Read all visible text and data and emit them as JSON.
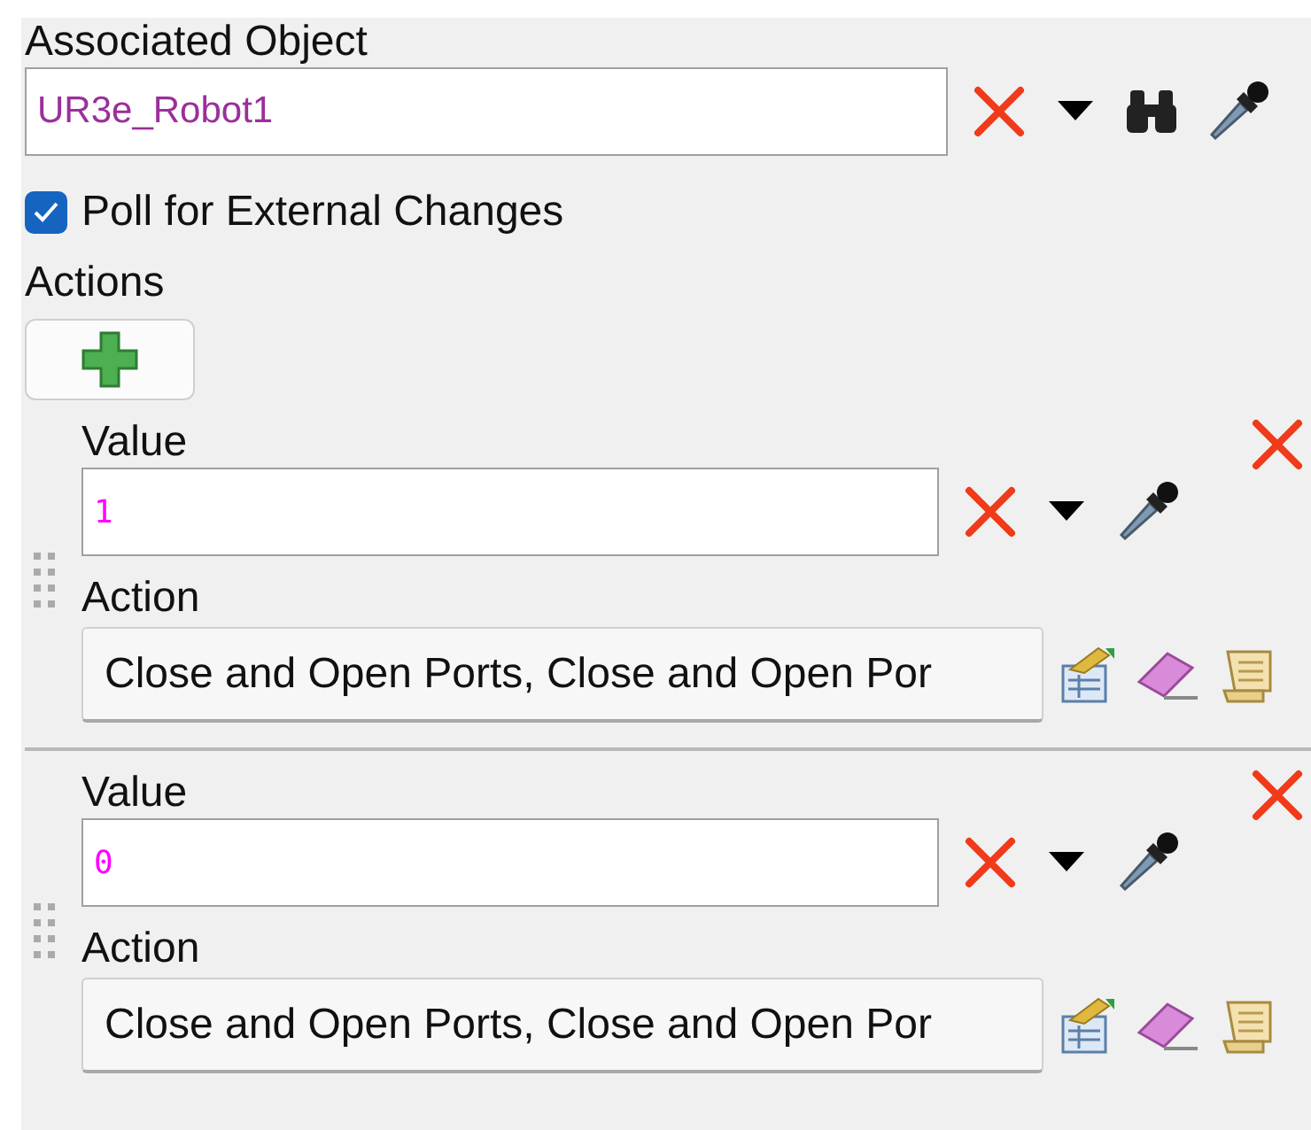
{
  "associated_object": {
    "label": "Associated Object",
    "value": "UR3e_Robot1"
  },
  "poll": {
    "label": "Poll for External Changes",
    "checked": true
  },
  "actions": {
    "label": "Actions",
    "items": [
      {
        "value_label": "Value",
        "value": "1",
        "action_label": "Action",
        "action": "Close and Open Ports, Close and Open Por"
      },
      {
        "value_label": "Value",
        "value": "0",
        "action_label": "Action",
        "action": "Close and Open Ports, Close and Open Por"
      }
    ]
  }
}
